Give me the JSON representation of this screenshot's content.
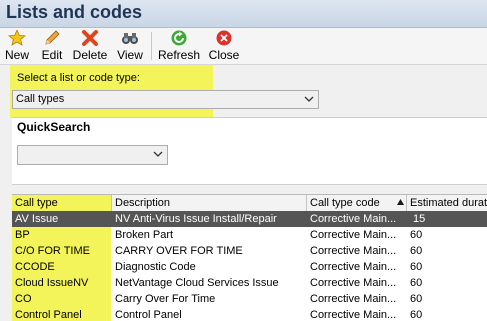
{
  "window": {
    "title": "Lists and codes"
  },
  "toolbar": {
    "buttons": [
      {
        "label": "New",
        "icon": "star-icon"
      },
      {
        "label": "Edit",
        "icon": "pencil-icon"
      },
      {
        "label": "Delete",
        "icon": "delete-x-icon"
      },
      {
        "label": "View",
        "icon": "binoculars-icon"
      },
      {
        "label": "Refresh",
        "icon": "refresh-icon"
      },
      {
        "label": "Close",
        "icon": "close-icon"
      }
    ]
  },
  "list_type": {
    "label": "Select a list or code type:",
    "selected": "Call types"
  },
  "quicksearch": {
    "title": "QuickSearch",
    "selected": ""
  },
  "table": {
    "columns": [
      "Call type",
      "Description",
      "Call type code",
      "Estimated durati"
    ],
    "rows": [
      [
        "AV Issue",
        "NV Anti-Virus Issue Install/Repair",
        "Corrective Main...",
        "15"
      ],
      [
        "BP",
        "Broken Part",
        "Corrective Main...",
        "60"
      ],
      [
        "C/O FOR TIME",
        "CARRY OVER FOR TIME",
        "Corrective Main...",
        "60"
      ],
      [
        "CCODE",
        "Diagnostic Code",
        "Corrective Main...",
        "60"
      ],
      [
        "Cloud IssueNV",
        "NetVantage Cloud Services Issue",
        "Corrective Main...",
        "60"
      ],
      [
        "CO",
        "Carry Over For Time",
        "Corrective Main...",
        "60"
      ],
      [
        "Control Panel",
        "Control Panel",
        "Corrective Main...",
        "60"
      ]
    ]
  },
  "colors": {
    "highlight": "#f3f35a",
    "selected_row": "#555555",
    "title_text": "#1f3556"
  }
}
